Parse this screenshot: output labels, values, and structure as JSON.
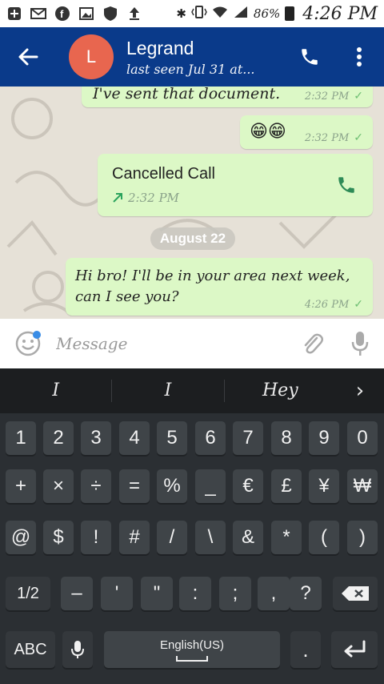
{
  "status_bar": {
    "battery": "86%",
    "time": "4:26 PM",
    "icons": [
      "plus-icon",
      "mail-icon",
      "facebook-icon",
      "gallery-icon",
      "shield-icon",
      "upload-icon",
      "bluetooth-icon",
      "vibrate-icon",
      "wifi-icon",
      "signal-icon",
      "battery-icon"
    ]
  },
  "header": {
    "avatar_letter": "L",
    "contact_name": "Legrand",
    "last_seen": "last seen Jul 31 at...",
    "accent": "#0a3a8a",
    "avatar_color": "#e8664f"
  },
  "messages": [
    {
      "text": "I've sent that document.",
      "time": "2:32 PM"
    },
    {
      "text": "😁😁",
      "time": "2:32 PM"
    },
    {
      "text": "Cancelled Call",
      "time": "2:32 PM"
    },
    {
      "text": "Hi bro! I'll be in your area next week, can I see you?",
      "time": "4:26 PM"
    }
  ],
  "date_separator": "August 22",
  "composer": {
    "placeholder": "Message"
  },
  "keyboard": {
    "suggestions": [
      "I",
      "I",
      "Hey"
    ],
    "row1": [
      "1",
      "2",
      "3",
      "4",
      "5",
      "6",
      "7",
      "8",
      "9",
      "0"
    ],
    "row2": [
      "+",
      "×",
      "÷",
      "=",
      "%",
      "_",
      "€",
      "£",
      "¥",
      "₩"
    ],
    "row3": [
      "@",
      "$",
      "!",
      "#",
      "/",
      "\\",
      "&",
      "*",
      "(",
      ")"
    ],
    "row4": [
      "1/2",
      "–",
      "'",
      "\"",
      ":",
      ";",
      ",",
      "?"
    ],
    "abc_label": "ABC",
    "space_label": "English(US)"
  }
}
